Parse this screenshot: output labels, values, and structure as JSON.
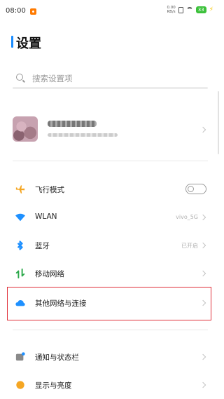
{
  "status_bar": {
    "time": "08:00",
    "speed_top": "0.00",
    "speed_bottom": "KB/s",
    "battery": "33",
    "charging": "⚡"
  },
  "page": {
    "title": "设置"
  },
  "search": {
    "placeholder": "搜索设置项"
  },
  "items": [
    {
      "label": "飞行模式",
      "value": "",
      "control": "toggle-off",
      "icon": "airplane-icon"
    },
    {
      "label": "WLAN",
      "value": "vivo_5G",
      "control": "chevron",
      "icon": "wifi-icon"
    },
    {
      "label": "蓝牙",
      "value": "已开启",
      "control": "chevron",
      "icon": "bluetooth-icon"
    },
    {
      "label": "移动网络",
      "value": "",
      "control": "chevron",
      "icon": "mobile-data-icon"
    },
    {
      "label": "其他网络与连接",
      "value": "",
      "control": "chevron",
      "icon": "cloud-icon",
      "highlighted": true
    },
    {
      "label": "通知与状态栏",
      "value": "",
      "control": "chevron",
      "icon": "notification-icon"
    },
    {
      "label": "显示与亮度",
      "value": "",
      "control": "chevron",
      "icon": "brightness-icon"
    }
  ],
  "colors": {
    "accent": "#1a8cff",
    "airplane": "#f5a623",
    "wifi": "#1e90ff",
    "bluetooth": "#1e90ff",
    "mobile_data": "#2ba84a",
    "cloud": "#1e90ff",
    "brightness": "#f5a623",
    "highlight_border": "#e0303a",
    "battery": "#3cc13b"
  }
}
